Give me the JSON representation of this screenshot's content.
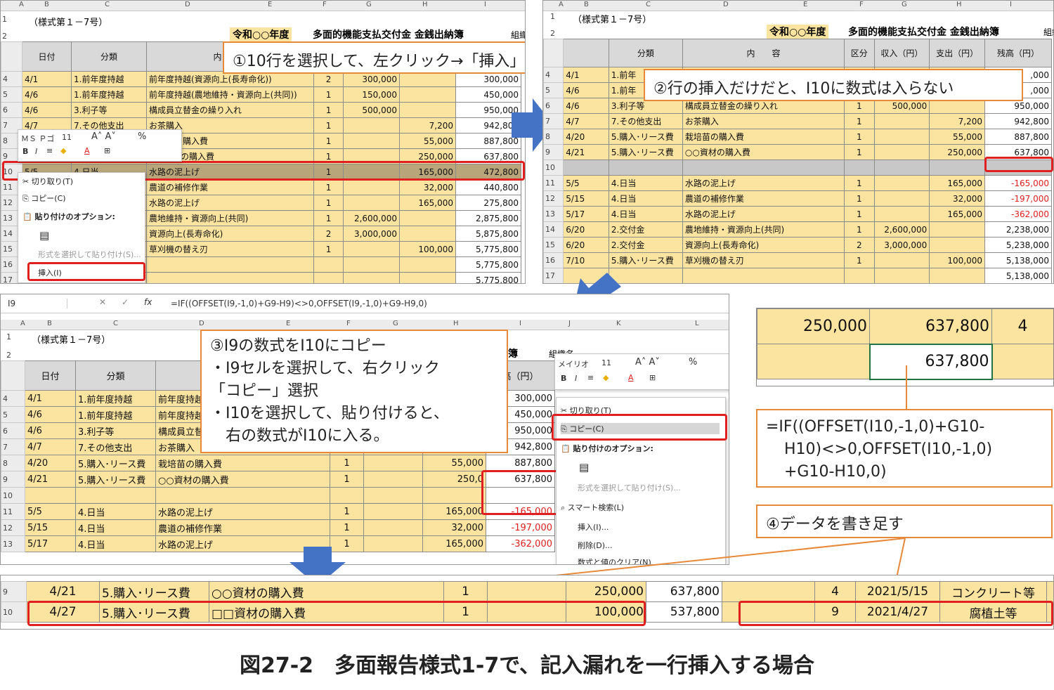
{
  "caption": "図27-2　多面報告様式1-7で、記入漏れを一行挿入する場合",
  "callouts": {
    "step1": "①10行を選択して、左クリック→「挿入」",
    "step2": "②行の挿入だけだと、I10に数式は入らない",
    "step3_lines": [
      "③I9の数式をI10にコピー",
      "・I9セルを選択して、右クリック",
      "「コピー」選択",
      "・I10を選択して、貼り付けると、",
      "　右の数式がI10に入る。"
    ],
    "formula_lines": [
      "=IF((OFFSET(I10,-1,0)+G10-",
      "H10)<>0,OFFSET(I10,-1,0)",
      "+G10-H10,0)"
    ],
    "step4": "④データを書き足す"
  },
  "colors": {
    "accent": "#e8893a",
    "red": "#e02020",
    "arrow": "#4472c4",
    "cell_yellow": "#fbe3a0"
  },
  "sheet_common": {
    "form_no": "（様式第１－7号）",
    "year": "令和○○年度",
    "title": "多面的機能支払交付金 金銭出納簿",
    "group": "組織名：",
    "headers": {
      "date": "日付",
      "cat": "分類",
      "content": "内　　容",
      "kbn": "区分",
      "income": "収入（円）",
      "expense": "支出（円）",
      "balance": "残高（円）"
    }
  },
  "panel1": {
    "cols": [
      "A",
      "B",
      "C",
      "D",
      "E",
      "F",
      "G",
      "H",
      "I"
    ],
    "rows": [
      {
        "n": "4",
        "date": "4/1",
        "cat": "1.前年度持越",
        "content": "前年度持越(資源向上(長寿命化))",
        "kbn": "2",
        "inc": "300,000",
        "exp": "",
        "bal": "300,000"
      },
      {
        "n": "5",
        "date": "4/6",
        "cat": "1.前年度持越",
        "content": "前年度持越(農地維持・資源向上(共同))",
        "kbn": "1",
        "inc": "150,000",
        "exp": "",
        "bal": "450,000"
      },
      {
        "n": "6",
        "date": "4/6",
        "cat": "3.利子等",
        "content": "構成員立替金の繰り入れ",
        "kbn": "1",
        "inc": "500,000",
        "exp": "",
        "bal": "950,000"
      },
      {
        "n": "7",
        "date": "4/7",
        "cat": "7.その他支出",
        "content": "お茶購入",
        "kbn": "1",
        "inc": "",
        "exp": "7,200",
        "bal": "942,800"
      },
      {
        "n": "8",
        "date": "",
        "cat": "",
        "content": "栽培苗の購入費",
        "kbn": "1",
        "inc": "",
        "exp": "55,000",
        "bal": "887,800"
      },
      {
        "n": "9",
        "date": "",
        "cat": "",
        "content": "○○資材の購入費",
        "kbn": "1",
        "inc": "",
        "exp": "250,000",
        "bal": "637,800"
      },
      {
        "n": "10",
        "date": "5/5",
        "cat": "4.日当",
        "content": "水路の泥上げ",
        "kbn": "1",
        "inc": "",
        "exp": "165,000",
        "bal": "472,800"
      },
      {
        "n": "11",
        "date": "",
        "cat": "",
        "content": "農道の補修作業",
        "kbn": "1",
        "inc": "",
        "exp": "32,000",
        "bal": "440,800"
      },
      {
        "n": "12",
        "date": "",
        "cat": "",
        "content": "水路の泥上げ",
        "kbn": "1",
        "inc": "",
        "exp": "165,000",
        "bal": "275,800"
      },
      {
        "n": "13",
        "date": "",
        "cat": "",
        "content": "農地維持・資源向上(共同)",
        "kbn": "1",
        "inc": "2,600,000",
        "exp": "",
        "bal": "2,875,800"
      },
      {
        "n": "14",
        "date": "",
        "cat": "",
        "content": "資源向上(長寿命化)",
        "kbn": "2",
        "inc": "3,000,000",
        "exp": "",
        "bal": "5,875,800"
      },
      {
        "n": "15",
        "date": "",
        "cat": "",
        "content": "草刈機の替え刃",
        "kbn": "1",
        "inc": "",
        "exp": "100,000",
        "bal": "5,775,800"
      },
      {
        "n": "16",
        "date": "",
        "cat": "",
        "content": "",
        "kbn": "",
        "inc": "",
        "exp": "",
        "bal": "5,775,800"
      },
      {
        "n": "17",
        "date": "",
        "cat": "",
        "content": "",
        "kbn": "",
        "inc": "",
        "exp": "",
        "bal": "5,775,800"
      }
    ],
    "mini_toolbar": {
      "font": "ＭＳ Ｐゴ",
      "size": "11"
    },
    "context_menu": {
      "cut": "切り取り(T)",
      "copy": "コピー(C)",
      "paste_opts": "貼り付けのオプション:",
      "paste_special": "形式を選択して貼り付け(S)...",
      "insert": "挿入(I)"
    }
  },
  "panel2": {
    "cols": [
      "A",
      "B",
      "C",
      "D",
      "E",
      "F",
      "G",
      "H",
      "I"
    ],
    "rows": [
      {
        "n": "4",
        "date": "4/1",
        "cat": "1.前年",
        "content": "",
        "kbn": "",
        "inc": "",
        "exp": "",
        "bal": ",000"
      },
      {
        "n": "5",
        "date": "4/6",
        "cat": "1.前年",
        "content": "",
        "kbn": "",
        "inc": "",
        "exp": "",
        "bal": ",000"
      },
      {
        "n": "6",
        "date": "4/6",
        "cat": "3.利子等",
        "content": "構成員立替金の繰り入れ",
        "kbn": "1",
        "inc": "500,000",
        "exp": "",
        "bal": "950,000"
      },
      {
        "n": "7",
        "date": "4/7",
        "cat": "7.その他支出",
        "content": "お茶購入",
        "kbn": "1",
        "inc": "",
        "exp": "7,200",
        "bal": "942,800"
      },
      {
        "n": "8",
        "date": "4/20",
        "cat": "5.購入･リース費",
        "content": "栽培苗の購入費",
        "kbn": "1",
        "inc": "",
        "exp": "55,000",
        "bal": "887,800"
      },
      {
        "n": "9",
        "date": "4/21",
        "cat": "5.購入･リース費",
        "content": "○○資材の購入費",
        "kbn": "1",
        "inc": "",
        "exp": "250,000",
        "bal": "637,800"
      },
      {
        "n": "10",
        "date": "",
        "cat": "",
        "content": "",
        "kbn": "",
        "inc": "",
        "exp": "",
        "bal": ""
      },
      {
        "n": "11",
        "date": "5/5",
        "cat": "4.日当",
        "content": "水路の泥上げ",
        "kbn": "1",
        "inc": "",
        "exp": "165,000",
        "bal": "-165,000"
      },
      {
        "n": "12",
        "date": "5/15",
        "cat": "4.日当",
        "content": "農道の補修作業",
        "kbn": "1",
        "inc": "",
        "exp": "32,000",
        "bal": "-197,000"
      },
      {
        "n": "13",
        "date": "5/17",
        "cat": "4.日当",
        "content": "水路の泥上げ",
        "kbn": "1",
        "inc": "",
        "exp": "165,000",
        "bal": "-362,000"
      },
      {
        "n": "14",
        "date": "6/20",
        "cat": "2.交付金",
        "content": "農地維持・資源向上(共同)",
        "kbn": "1",
        "inc": "2,600,000",
        "exp": "",
        "bal": "2,238,000"
      },
      {
        "n": "15",
        "date": "6/20",
        "cat": "2.交付金",
        "content": "資源向上(長寿命化)",
        "kbn": "2",
        "inc": "3,000,000",
        "exp": "",
        "bal": "5,238,000"
      },
      {
        "n": "16",
        "date": "7/10",
        "cat": "5.購入･リース費",
        "content": "草刈機の替え刃",
        "kbn": "1",
        "inc": "",
        "exp": "100,000",
        "bal": "5,138,000"
      },
      {
        "n": "17",
        "date": "",
        "cat": "",
        "content": "",
        "kbn": "",
        "inc": "",
        "exp": "",
        "bal": "5,138,000"
      }
    ]
  },
  "panel3": {
    "name_box": "I9",
    "formula": "=IF((OFFSET(I9,-1,0)+G9-H9)<>0,OFFSET(I9,-1,0)+G9-H9,0)",
    "fx": "fx",
    "cols": [
      "A",
      "B",
      "C",
      "D",
      "E",
      "F",
      "G",
      "H",
      "I",
      "J",
      "K",
      "L"
    ],
    "rows": [
      {
        "n": "4",
        "date": "4/1",
        "cat": "1.前年度持越",
        "content": "前年度持越",
        "kbn": "",
        "inc": "",
        "exp": "",
        "bal": "300,000"
      },
      {
        "n": "5",
        "date": "4/6",
        "cat": "1.前年度持越",
        "content": "前年度持越",
        "kbn": "",
        "inc": "",
        "exp": "",
        "bal": "450,000"
      },
      {
        "n": "6",
        "date": "4/6",
        "cat": "3.利子等",
        "content": "構成員立替",
        "kbn": "",
        "inc": "",
        "exp": "",
        "bal": "950,000"
      },
      {
        "n": "7",
        "date": "4/7",
        "cat": "7.その他支出",
        "content": "お茶購入",
        "kbn": "",
        "inc": "",
        "exp": "",
        "bal": "942,800"
      },
      {
        "n": "8",
        "date": "4/20",
        "cat": "5.購入･リース費",
        "content": "栽培苗の購入費",
        "kbn": "1",
        "inc": "",
        "exp": "55,000",
        "bal": "887,800"
      },
      {
        "n": "9",
        "date": "4/21",
        "cat": "5.購入･リース費",
        "content": "○○資材の購入費",
        "kbn": "1",
        "inc": "",
        "exp": "250,0",
        "bal": "637,800"
      },
      {
        "n": "10",
        "date": "",
        "cat": "",
        "content": "",
        "kbn": "",
        "inc": "",
        "exp": "",
        "bal": ""
      },
      {
        "n": "11",
        "date": "5/5",
        "cat": "4.日当",
        "content": "水路の泥上げ",
        "kbn": "1",
        "inc": "",
        "exp": "165,000",
        "bal": "-165,000"
      },
      {
        "n": "12",
        "date": "5/15",
        "cat": "4.日当",
        "content": "農道の補修作業",
        "kbn": "1",
        "inc": "",
        "exp": "32,000",
        "bal": "-197,000"
      },
      {
        "n": "13",
        "date": "5/17",
        "cat": "4.日当",
        "content": "水路の泥上げ",
        "kbn": "1",
        "inc": "",
        "exp": "165,000",
        "bal": "-362,000"
      }
    ],
    "header_partial": "簿",
    "group_partial": "組織名",
    "bal_header_partial": "高（円）",
    "mini_toolbar": {
      "font": "メイリオ",
      "size": "11"
    },
    "context_menu": {
      "cut": "切り取り(T)",
      "copy": "コピー(C)",
      "paste_opts": "貼り付けのオプション:",
      "paste_special": "形式を選択して貼り付け(S)...",
      "smart": "スマート検索(L)",
      "insert": "挿入(I)...",
      "delete": "削除(D)...",
      "clear": "数式と値のクリア(N)"
    }
  },
  "zoom_cells": {
    "r1": [
      "250,000",
      "637,800",
      "4"
    ],
    "r2": [
      "",
      "637,800",
      ""
    ]
  },
  "result": {
    "rows": [
      {
        "n": "9",
        "date": "4/21",
        "cat": "5.購入･リース費",
        "content": "○○資材の購入費",
        "kbn": "1",
        "inc": "",
        "exp": "250,000",
        "bal": "637,800",
        "k": "4",
        "date2": "2021/5/15",
        "item": "コンクリート等"
      },
      {
        "n": "10",
        "date": "4/27",
        "cat": "5.購入･リース費",
        "content": "□□資材の購入費",
        "kbn": "1",
        "inc": "",
        "exp": "100,000",
        "bal": "537,800",
        "k": "9",
        "date2": "2021/4/27",
        "item": "腐植土等"
      }
    ]
  }
}
